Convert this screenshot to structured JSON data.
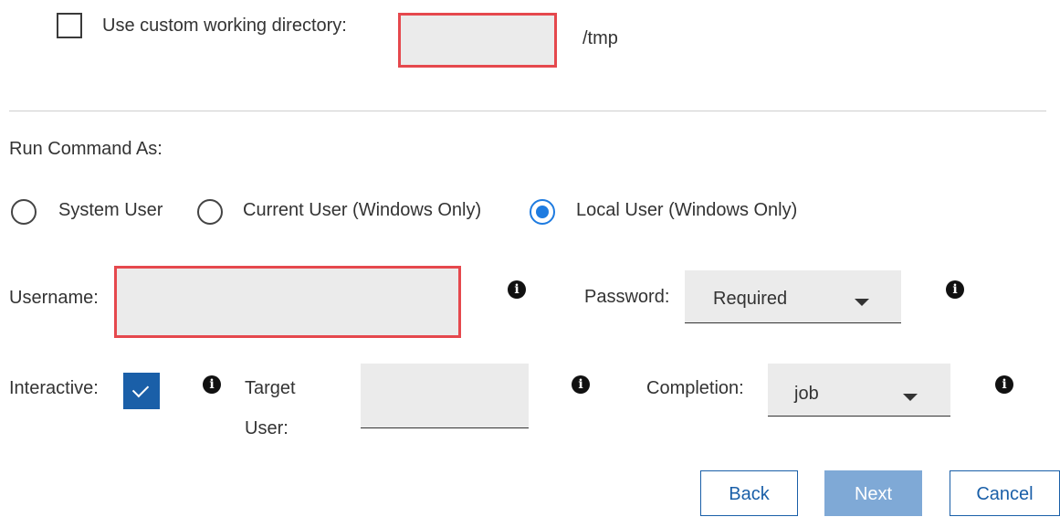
{
  "working_directory": {
    "checkbox_label": "Use custom working directory:",
    "checked": false,
    "value": "",
    "suffix": "/tmp"
  },
  "run_as": {
    "heading": "Run Command As:",
    "options": [
      {
        "label": "System User",
        "selected": false
      },
      {
        "label": "Current User (Windows Only)",
        "selected": false
      },
      {
        "label": "Local User (Windows Only)",
        "selected": true
      }
    ]
  },
  "credentials": {
    "username_label": "Username:",
    "username_value": "",
    "password_label": "Password:",
    "password_value": "Required"
  },
  "options_row": {
    "interactive_label": "Interactive:",
    "interactive_checked": true,
    "target_user_label_line1": "Target",
    "target_user_label_line2": "User:",
    "target_user_value": "",
    "completion_label": "Completion:",
    "completion_value": "job"
  },
  "footer": {
    "back_label": "Back",
    "next_label": "Next",
    "cancel_label": "Cancel"
  },
  "colors": {
    "accent": "#1a5fa8",
    "radio_selected": "#1e7be0",
    "error_border": "#e5484d",
    "field_bg": "#ebebeb",
    "next_disabled": "#7fa9d6"
  }
}
